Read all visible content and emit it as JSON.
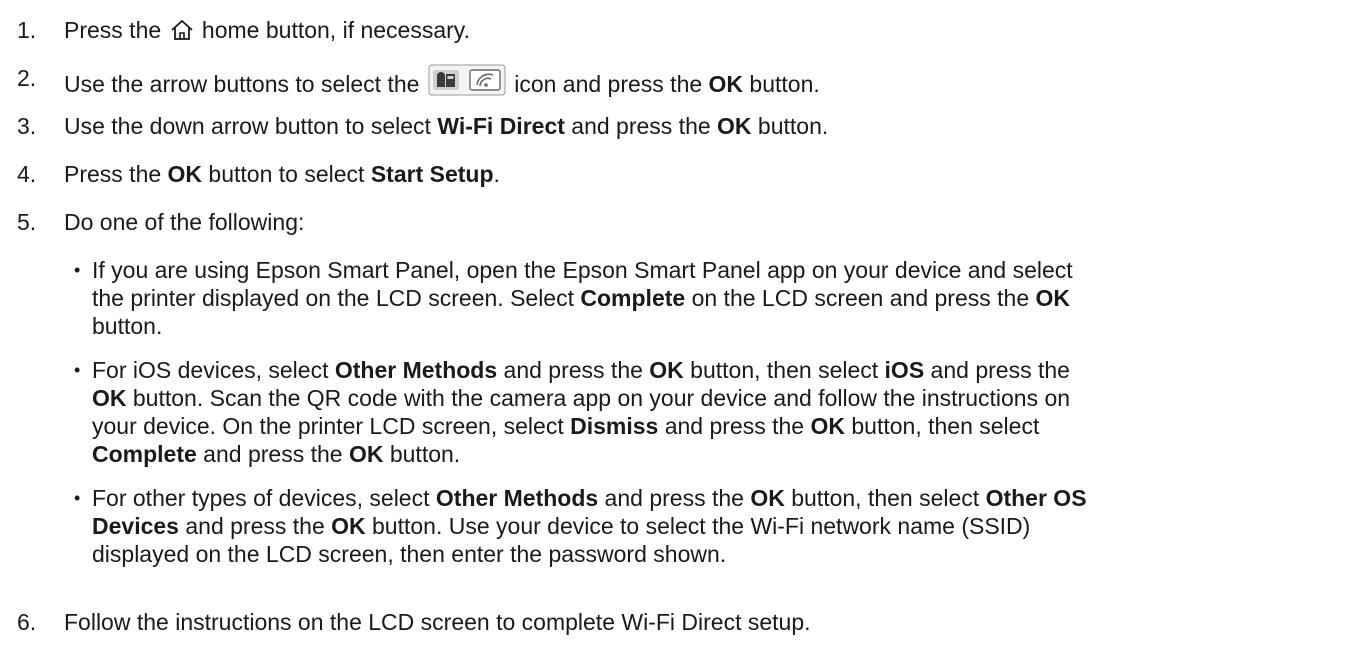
{
  "steps": [
    {
      "n": "1.",
      "parts": [
        "Press the ",
        "{home-icon}",
        " home button, if necessary."
      ]
    },
    {
      "n": "2.",
      "parts": [
        "Use the arrow buttons to select the ",
        "{network-icon}",
        " icon and press the ",
        "**OK",
        " button."
      ]
    },
    {
      "n": "3.",
      "parts": [
        "Use the down arrow button to select ",
        "**Wi-Fi Direct",
        " and press the ",
        "**OK",
        " button."
      ]
    },
    {
      "n": "4.",
      "parts": [
        "Press the ",
        "**OK",
        " button to select ",
        "**Start Setup",
        "."
      ]
    },
    {
      "n": "5.",
      "parts": [
        "Do one of the following:"
      ]
    },
    {
      "n": "6.",
      "parts": [
        "Follow the instructions on the LCD screen to complete Wi-Fi Direct setup."
      ]
    }
  ],
  "substeps": [
    {
      "lines": [
        [
          "If you are using Epson Smart Panel, open the Epson Smart Panel app on your device and select"
        ],
        [
          "the printer displayed on the LCD screen. Select ",
          "**Complete",
          " on the LCD screen and press the ",
          "**OK"
        ],
        [
          "button."
        ]
      ]
    },
    {
      "lines": [
        [
          "For iOS devices, select ",
          "**Other Methods",
          " and press the ",
          "**OK",
          " button, then select ",
          "**iOS",
          " and press the"
        ],
        [
          "**OK",
          " button. Scan the QR code with the camera app on your device and follow the instructions on"
        ],
        [
          "your device. On the printer LCD screen, select ",
          "**Dismiss",
          " and press the ",
          "**OK",
          " button, then select"
        ],
        [
          "**Complete",
          " and press the ",
          "**OK",
          " button."
        ]
      ]
    },
    {
      "lines": [
        [
          "For other types of devices, select ",
          "**Other Methods",
          " and press the ",
          "**OK",
          " button, then select ",
          "**Other OS"
        ],
        [
          "**Devices",
          " and press the ",
          "**OK",
          " button. Use your device to select the Wi-Fi network name (SSID)"
        ],
        [
          "displayed on the LCD screen, then enter the password shown."
        ]
      ]
    }
  ],
  "bullet_char": "•",
  "icons": {
    "home": "home-icon",
    "network": "network-icon"
  }
}
